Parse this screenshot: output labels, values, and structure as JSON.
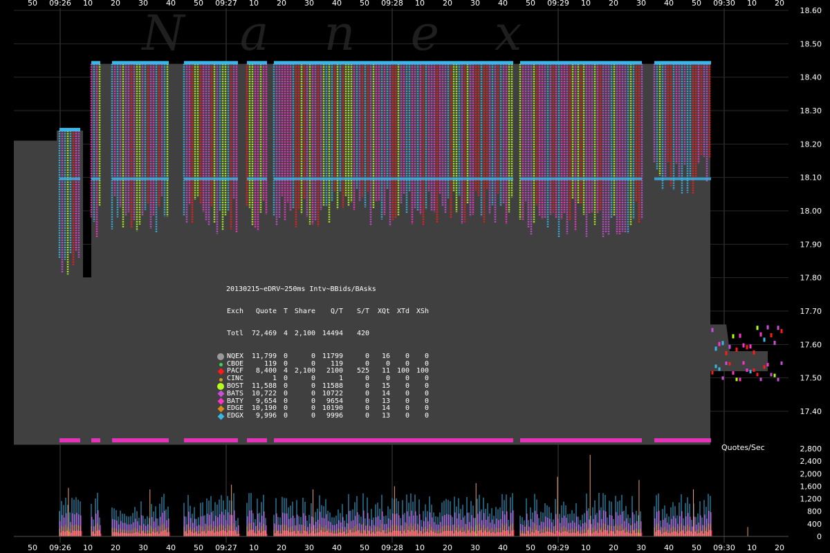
{
  "watermark": "Nanex",
  "quotes_label": "Quotes/Sec",
  "time_axis": {
    "ticks": [
      "50",
      "09:26",
      "10",
      "20",
      "30",
      "40",
      "50",
      "09:27",
      "10",
      "20",
      "30",
      "40",
      "50",
      "09:28",
      "10",
      "20",
      "30",
      "40",
      "50",
      "09:29",
      "10",
      "20",
      "30",
      "40",
      "50",
      "09:30",
      "10",
      "20"
    ]
  },
  "price_axis": {
    "labels": [
      "18.60",
      "18.50",
      "18.40",
      "18.30",
      "18.20",
      "18.10",
      "18.00",
      "17.90",
      "17.80",
      "17.70",
      "17.60",
      "17.50",
      "17.40"
    ]
  },
  "volume_axis": {
    "labels": [
      "2,800",
      "2,400",
      "2,000",
      "1,600",
      "1,200",
      "800",
      "400",
      "0"
    ]
  },
  "colors": {
    "NQEX": "#9a9a9a",
    "CBOE": "#39d84a",
    "PACF": "#ff1a1a",
    "CINC": "#d4a017",
    "BOST": "#b6ff1a",
    "BATS": "#c94ed8",
    "BATY": "#ff33cc",
    "EDGE": "#d98a1c",
    "EDGX": "#3ab6e8",
    "panel": "#404040",
    "grid": "#2a2a2a"
  },
  "stats_table": {
    "title": "20130215~eDRV~250ms Intv~BBids/BAsks",
    "headers": [
      "Exch",
      "Quote",
      "T",
      "Share",
      "Q/T",
      "S/T",
      "XQt",
      "XTd",
      "XSh"
    ],
    "total": [
      "Totl",
      "72,469",
      "4",
      "2,100",
      "14494",
      "420",
      "",
      "",
      ""
    ],
    "rows": [
      {
        "exch": "NQEX",
        "marker": "circle",
        "color": "#9a9a9a",
        "cells": [
          "11,799",
          "0",
          "0",
          "11799",
          "0",
          "16",
          "0",
          "0"
        ]
      },
      {
        "exch": "CBOE",
        "marker": "dot",
        "color": "#39d84a",
        "cells": [
          "119",
          "0",
          "0",
          "119",
          "0",
          "0",
          "0",
          "0"
        ]
      },
      {
        "exch": "PACF",
        "marker": "diamond",
        "color": "#ff1a1a",
        "cells": [
          "8,400",
          "4",
          "2,100",
          "2100",
          "525",
          "11",
          "100",
          "100"
        ]
      },
      {
        "exch": "CINC",
        "marker": "dot",
        "color": "#d4a017",
        "cells": [
          "1",
          "0",
          "0",
          "1",
          "0",
          "0",
          "0",
          "0"
        ]
      },
      {
        "exch": "BOST",
        "marker": "circle",
        "color": "#b6ff1a",
        "cells": [
          "11,588",
          "0",
          "0",
          "11588",
          "0",
          "15",
          "0",
          "0"
        ]
      },
      {
        "exch": "BATS",
        "marker": "diamond",
        "color": "#c94ed8",
        "cells": [
          "10,722",
          "0",
          "0",
          "10722",
          "0",
          "14",
          "0",
          "0"
        ]
      },
      {
        "exch": "BATY",
        "marker": "diamond",
        "color": "#ff33cc",
        "cells": [
          "9,654",
          "0",
          "0",
          "9654",
          "0",
          "13",
          "0",
          "0"
        ]
      },
      {
        "exch": "EDGE",
        "marker": "diamond",
        "color": "#d98a1c",
        "cells": [
          "10,190",
          "0",
          "0",
          "10190",
          "0",
          "14",
          "0",
          "0"
        ]
      },
      {
        "exch": "EDGX",
        "marker": "diamond",
        "color": "#3ab6e8",
        "cells": [
          "9,996",
          "0",
          "0",
          "9996",
          "0",
          "13",
          "0",
          "0"
        ]
      }
    ]
  },
  "chart_data": {
    "type": "area",
    "title": "20130215~eDRV~250ms Intv~BBids/BAsks",
    "x_unit": "time",
    "price_ylim": [
      17.3,
      18.6
    ],
    "volume_ylim": [
      0,
      2800
    ],
    "nbbo_series": {
      "name": "NBBO",
      "segments": [
        {
          "t": "09:25:45",
          "bid": 18.2,
          "ask": 18.24
        },
        {
          "t": "09:26:00",
          "bid": 17.8,
          "ask": 18.24
        },
        {
          "t": "09:26:05",
          "bid": 17.9,
          "ask": 18.44
        },
        {
          "t": "09:26:30",
          "bid": 17.92,
          "ask": 18.45
        },
        {
          "t": "09:27:00",
          "bid": 17.93,
          "ask": 18.45
        },
        {
          "t": "09:27:30",
          "bid": 17.93,
          "ask": 18.45
        },
        {
          "t": "09:28:00",
          "bid": 17.97,
          "ask": 18.45
        },
        {
          "t": "09:28:30",
          "bid": 17.98,
          "ask": 18.45
        },
        {
          "t": "09:29:00",
          "bid": 17.98,
          "ask": 18.45
        },
        {
          "t": "09:29:30",
          "bid": 18.0,
          "ask": 18.45
        },
        {
          "t": "09:29:55",
          "bid": 17.65,
          "ask": 18.07
        },
        {
          "t": "09:30:05",
          "bid": 17.52,
          "ask": 17.62
        },
        {
          "t": "09:30:20",
          "bid": 17.55,
          "ask": 17.64
        }
      ]
    },
    "quote_rate_peaks": [
      {
        "t": "09:26:00",
        "value": 1550
      },
      {
        "t": "09:26:30",
        "value": 1500
      },
      {
        "t": "09:27:00",
        "value": 1650
      },
      {
        "t": "09:27:30",
        "value": 1500
      },
      {
        "t": "09:28:00",
        "value": 1600
      },
      {
        "t": "09:28:30",
        "value": 1700
      },
      {
        "t": "09:29:00",
        "value": 1900
      },
      {
        "t": "09:29:12",
        "value": 2600
      },
      {
        "t": "09:29:30",
        "value": 1800
      },
      {
        "t": "09:29:50",
        "value": 1500
      },
      {
        "t": "09:30:10",
        "value": 300
      }
    ]
  }
}
